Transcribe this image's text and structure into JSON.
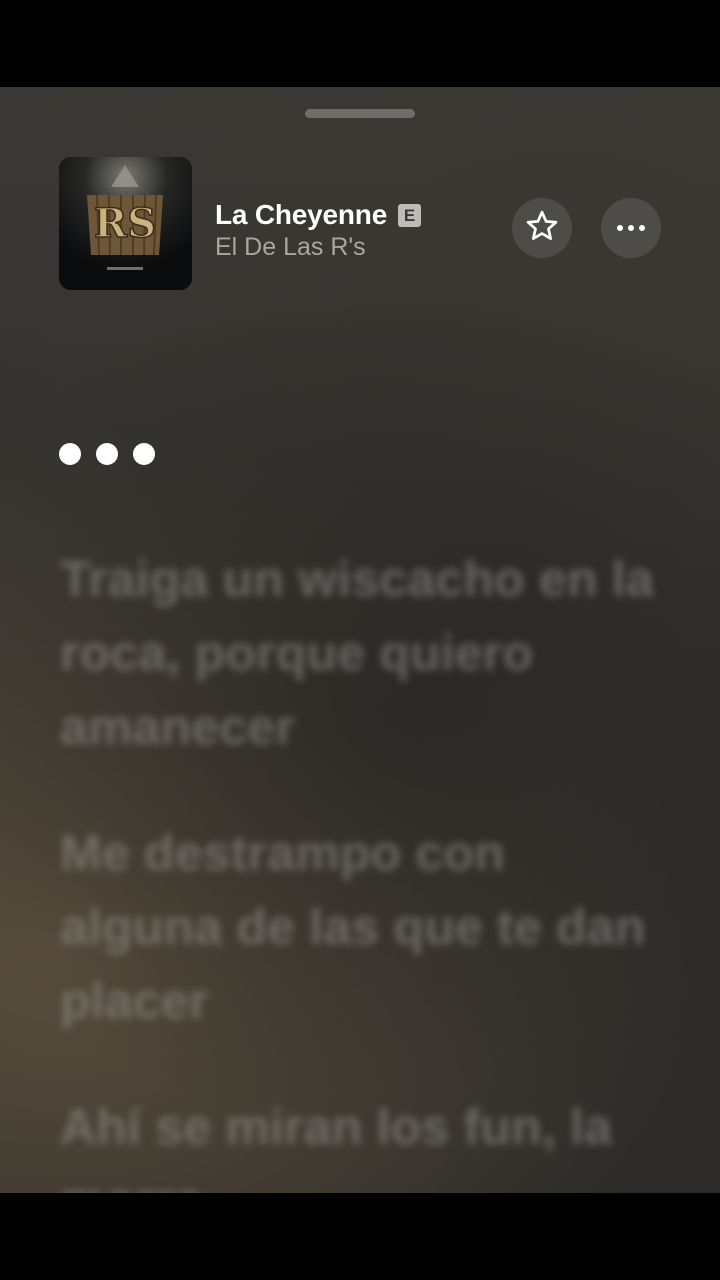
{
  "now_playing": {
    "title": "La Cheyenne",
    "explicit_badge": "E",
    "artist": "El De Las R's",
    "artwork_logo_text": "RS"
  },
  "buttons": {
    "favorite_icon": "star-outline-icon",
    "more_icon": "ellipsis-icon"
  },
  "lyrics": {
    "waiting_indicator": "three-dots",
    "lines": [
      "Traiga un wiscacho en la roca, porque quiero amanecer",
      "Me destrampo con alguna de las que te dan placer",
      "Ahí se miran los fun, la morra"
    ]
  },
  "colors": {
    "background": "#35332f",
    "title": "#ffffff",
    "artist": "#a9a7a2",
    "button_bg": "#4e4c48",
    "explicit_badge_bg": "#bdbcb8"
  }
}
